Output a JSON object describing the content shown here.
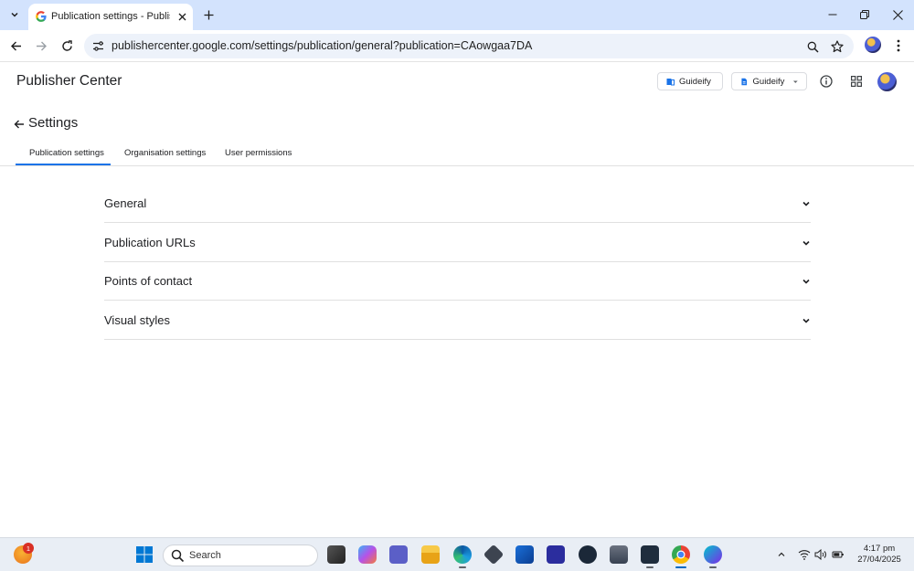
{
  "browser": {
    "tab_title": "Publication settings - Publisher Center",
    "url": "publishercenter.google.com/settings/publication/general?publication=CAowgaa7DA"
  },
  "app": {
    "title": "Publisher Center",
    "publication_chip_1": "Guideify",
    "publication_chip_2": "Guideify"
  },
  "settings": {
    "title": "Settings",
    "tabs": [
      {
        "label": "Publication settings",
        "active": true
      },
      {
        "label": "Organisation settings",
        "active": false
      },
      {
        "label": "User permissions",
        "active": false
      }
    ],
    "sections": [
      {
        "label": "General"
      },
      {
        "label": "Publication URLs"
      },
      {
        "label": "Points of contact"
      },
      {
        "label": "Visual styles"
      }
    ]
  },
  "taskbar": {
    "search_label": "Search",
    "notification_badge": "1",
    "time": "4:17 pm",
    "date": "27/04/2025"
  },
  "colors": {
    "accent": "#1a73e8",
    "tabstrip": "#d3e3fd",
    "omnibox": "#edf2fa"
  }
}
